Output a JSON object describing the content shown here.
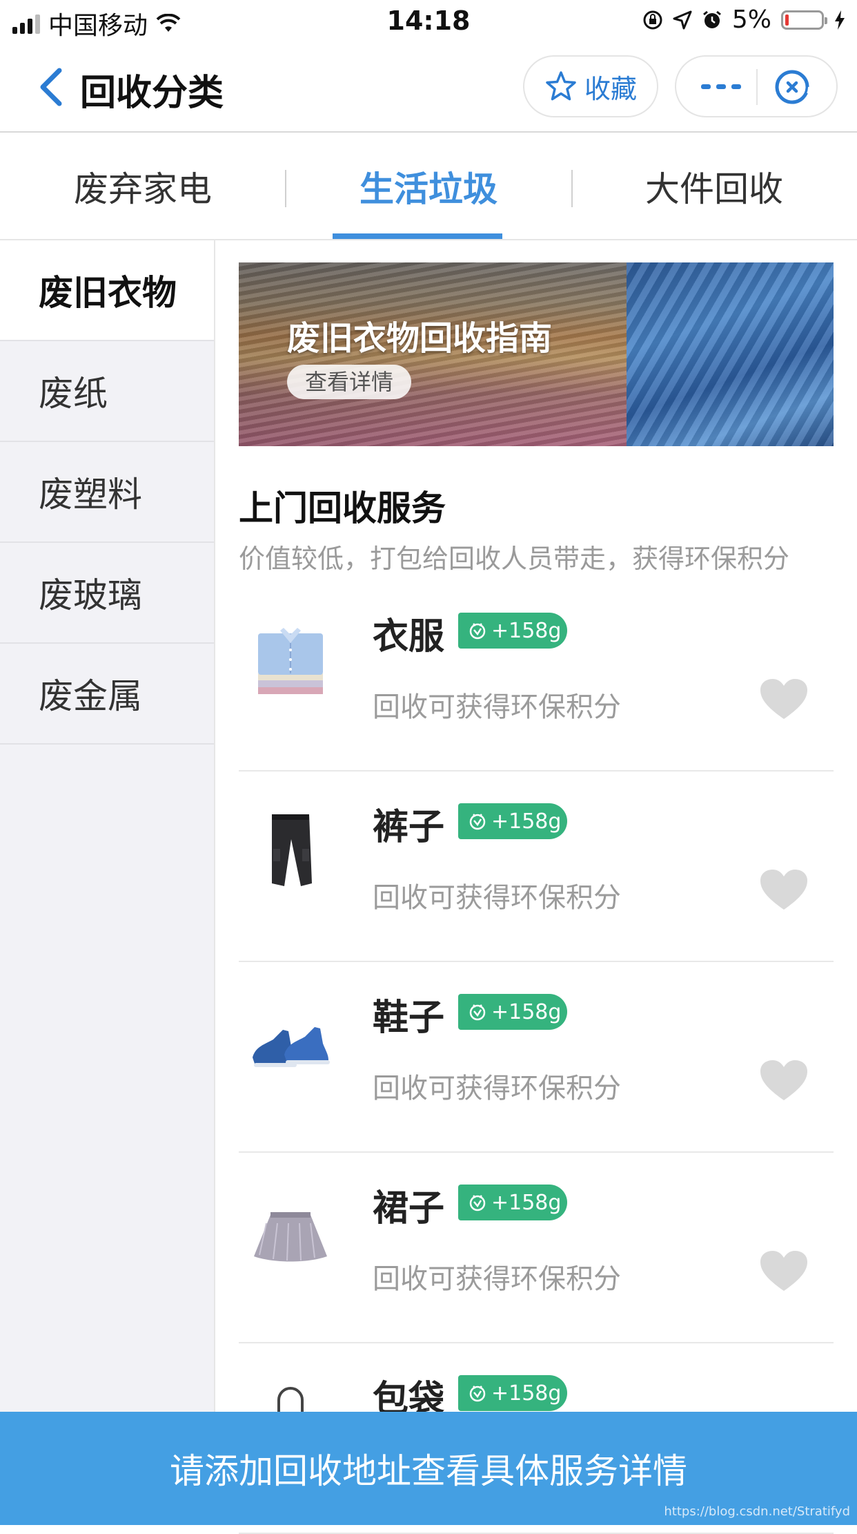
{
  "status_bar": {
    "carrier": "中国移动",
    "time": "14:18",
    "battery_percent": "5%"
  },
  "nav": {
    "title": "回收分类",
    "favorite_label": "收藏"
  },
  "tabs": [
    {
      "label": "废弃家电"
    },
    {
      "label": "生活垃圾"
    },
    {
      "label": "大件回收"
    }
  ],
  "sidebar": {
    "items": [
      {
        "label": "废旧衣物"
      },
      {
        "label": "废纸"
      },
      {
        "label": "废塑料"
      },
      {
        "label": "废玻璃"
      },
      {
        "label": "废金属"
      }
    ]
  },
  "banner": {
    "title": "废旧衣物回收指南",
    "button": "查看详情"
  },
  "section": {
    "title": "上门回收服务",
    "subtitle": "价值较低，打包给回收人员带走，获得环保积分"
  },
  "items": [
    {
      "name": "衣服",
      "badge": "+158g",
      "desc": "回收可获得环保积分"
    },
    {
      "name": "裤子",
      "badge": "+158g",
      "desc": "回收可获得环保积分"
    },
    {
      "name": "鞋子",
      "badge": "+158g",
      "desc": "回收可获得环保积分"
    },
    {
      "name": "裙子",
      "badge": "+158g",
      "desc": "回收可获得环保积分"
    },
    {
      "name": "包袋",
      "badge": "+158g",
      "desc": ""
    }
  ],
  "bottom_bar": {
    "label": "请添加回收地址查看具体服务详情"
  },
  "watermark": "https://blog.csdn.net/Stratifyd",
  "colors": {
    "accent": "#3f8fdd",
    "badge_green": "#35b37e",
    "bottom_bar": "#449fe3"
  }
}
